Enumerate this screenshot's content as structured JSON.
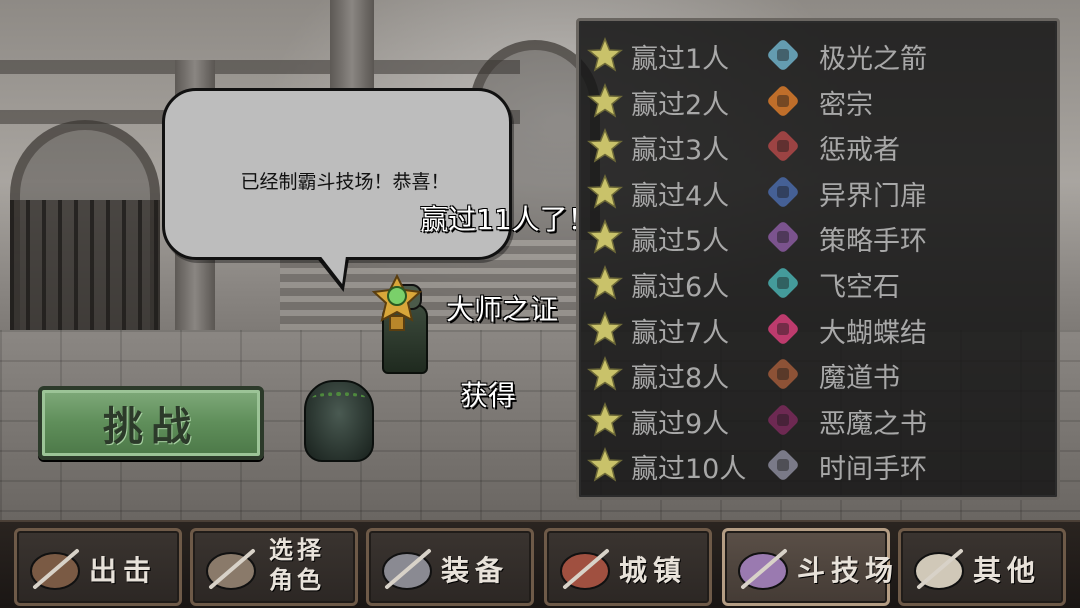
{
  "bubble": {
    "text": "已经制霸斗技场！恭喜！"
  },
  "floating": {
    "wins": "赢过11人了！",
    "badge": "大师之证",
    "obtained": "获得"
  },
  "challenge": {
    "label": "挑战"
  },
  "rewards": [
    {
      "requirement": "赢过1人",
      "item": "极光之箭",
      "icon": "arrow-icon",
      "color": "#6fb0c8"
    },
    {
      "requirement": "赢过2人",
      "item": "密宗",
      "icon": "spear-icon",
      "color": "#d97a2a"
    },
    {
      "requirement": "赢过3人",
      "item": "惩戒者",
      "icon": "hammer-icon",
      "color": "#b04848"
    },
    {
      "requirement": "赢过4人",
      "item": "异界门扉",
      "icon": "card-icon",
      "color": "#4a6aa8"
    },
    {
      "requirement": "赢过5人",
      "item": "策略手环",
      "icon": "bracelet-icon",
      "color": "#8a5aa0"
    },
    {
      "requirement": "赢过6人",
      "item": "飞空石",
      "icon": "crystal-icon",
      "color": "#4ab0b0"
    },
    {
      "requirement": "赢过7人",
      "item": "大蝴蝶结",
      "icon": "bow-icon",
      "color": "#d8407a"
    },
    {
      "requirement": "赢过8人",
      "item": "魔道书",
      "icon": "book-icon",
      "color": "#a05a3a"
    },
    {
      "requirement": "赢过9人",
      "item": "恶魔之书",
      "icon": "dark-book-icon",
      "color": "#7a2a5a"
    },
    {
      "requirement": "赢过10人",
      "item": "时间手环",
      "icon": "time-bracelet-icon",
      "color": "#8a8a9a"
    }
  ],
  "nav": [
    {
      "label": "出击",
      "icon": "sortie-icon",
      "two_line": false
    },
    {
      "label": "选择 角色",
      "icon": "character-icon",
      "two_line": true
    },
    {
      "label": "装备",
      "icon": "armor-icon",
      "two_line": false
    },
    {
      "label": "城镇",
      "icon": "town-icon",
      "two_line": false
    },
    {
      "label": "斗技场",
      "icon": "arena-icon",
      "two_line": false,
      "active": true
    },
    {
      "label": "其他",
      "icon": "scroll-icon",
      "two_line": false
    }
  ],
  "colors": {
    "star": "#c9c26a",
    "panel_text": "#a8a8a8",
    "challenge_green": "#5f8e5a"
  }
}
